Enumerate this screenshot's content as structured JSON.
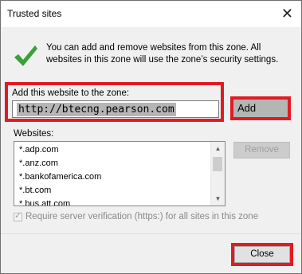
{
  "window": {
    "title": "Trusted sites",
    "close_glyph": "✕"
  },
  "intro": {
    "text": "You can add and remove websites from this zone. All websites in this zone will use the zone’s security settings."
  },
  "add_site": {
    "label": "Add this website to the zone:",
    "value": "http://btecng.pearson.com",
    "add_button": "Add"
  },
  "websites": {
    "label": "Websites:",
    "items": [
      "*.adp.com",
      "*.anz.com",
      "*.bankofamerica.com",
      "*.bt.com",
      "*.bus.att.com"
    ],
    "remove_button": "Remove"
  },
  "verification": {
    "label": "Require server verification (https:) for all sites in this zone",
    "checked": true
  },
  "footer": {
    "close_button": "Close"
  },
  "colors": {
    "highlight": "#e01b24",
    "check_green": "#3aa03a"
  }
}
